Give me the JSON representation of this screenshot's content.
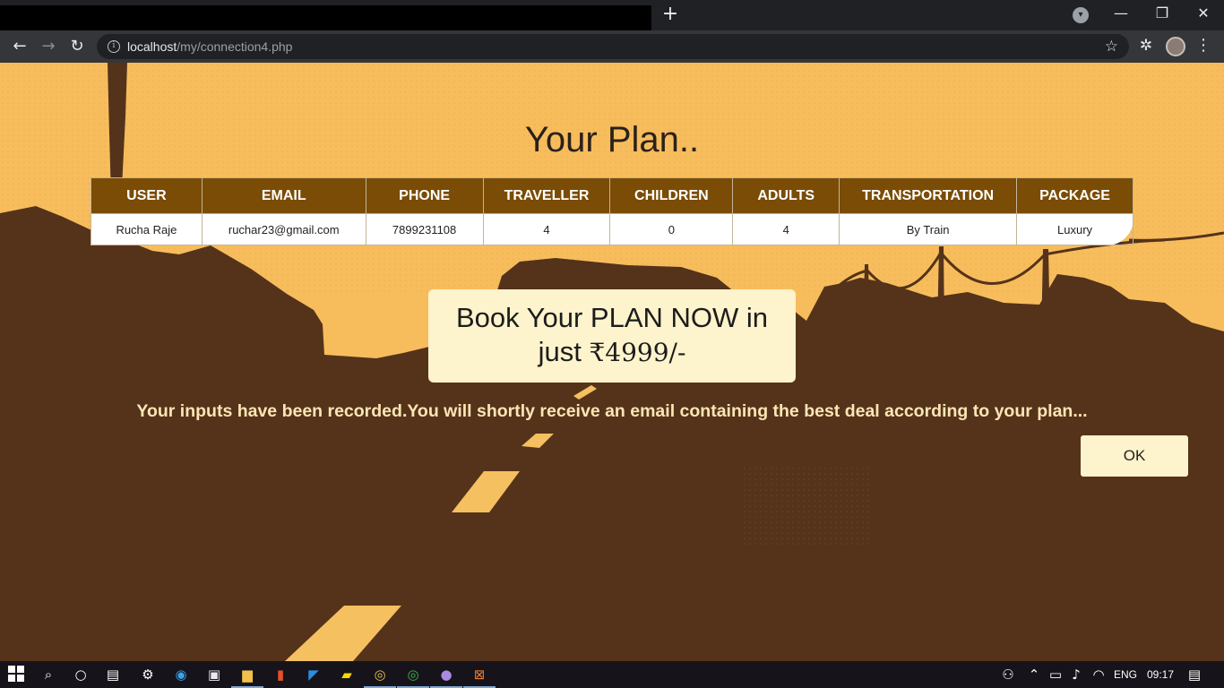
{
  "browser": {
    "new_tab_symbol": "+",
    "url_host": "localhost",
    "url_path": "/my/connection4.php",
    "icons": [
      "tab-search-icon",
      "minimize-icon",
      "restore-icon",
      "close-icon",
      "back-icon",
      "forward-icon",
      "reload-icon",
      "site-info-icon",
      "star-icon",
      "extensions-icon",
      "profile-avatar",
      "menu-icon"
    ]
  },
  "page": {
    "title": "Your Plan..",
    "table": {
      "headers": [
        "USER",
        "EMAIL",
        "PHONE",
        "TRAVELLER",
        "CHILDREN",
        "ADULTS",
        "TRANSPORTATION",
        "PACKAGE"
      ],
      "rows": [
        [
          "Rucha Raje",
          "ruchar23@gmail.com",
          "7899231108",
          "4",
          "0",
          "4",
          "By Train",
          "Luxury"
        ]
      ]
    },
    "book_line1": "Book Your PLAN NOW in",
    "book_just": "just",
    "book_price": "₹4999/-",
    "message": "Your inputs have been recorded.You will shortly receive an email containing the best deal according to your plan...",
    "ok_label": "OK"
  },
  "taskbar": {
    "apps": [
      "windows-start-icon",
      "search-icon",
      "cortana-icon",
      "task-view-icon",
      "settings-icon",
      "edge-icon",
      "store-icon",
      "file-explorer-icon",
      "office-icon",
      "vscode-icon",
      "sticky-notes-icon",
      "chrome-icon",
      "chrome-alt-icon",
      "github-icon",
      "xampp-icon"
    ],
    "language": "ENG",
    "time": "09:17"
  },
  "colors": {
    "sky": "#f7bd5d",
    "ground": "#55331a",
    "table_header": "#7a4c05",
    "box": "#fdf3cc",
    "message_text": "#fbe6b4"
  }
}
